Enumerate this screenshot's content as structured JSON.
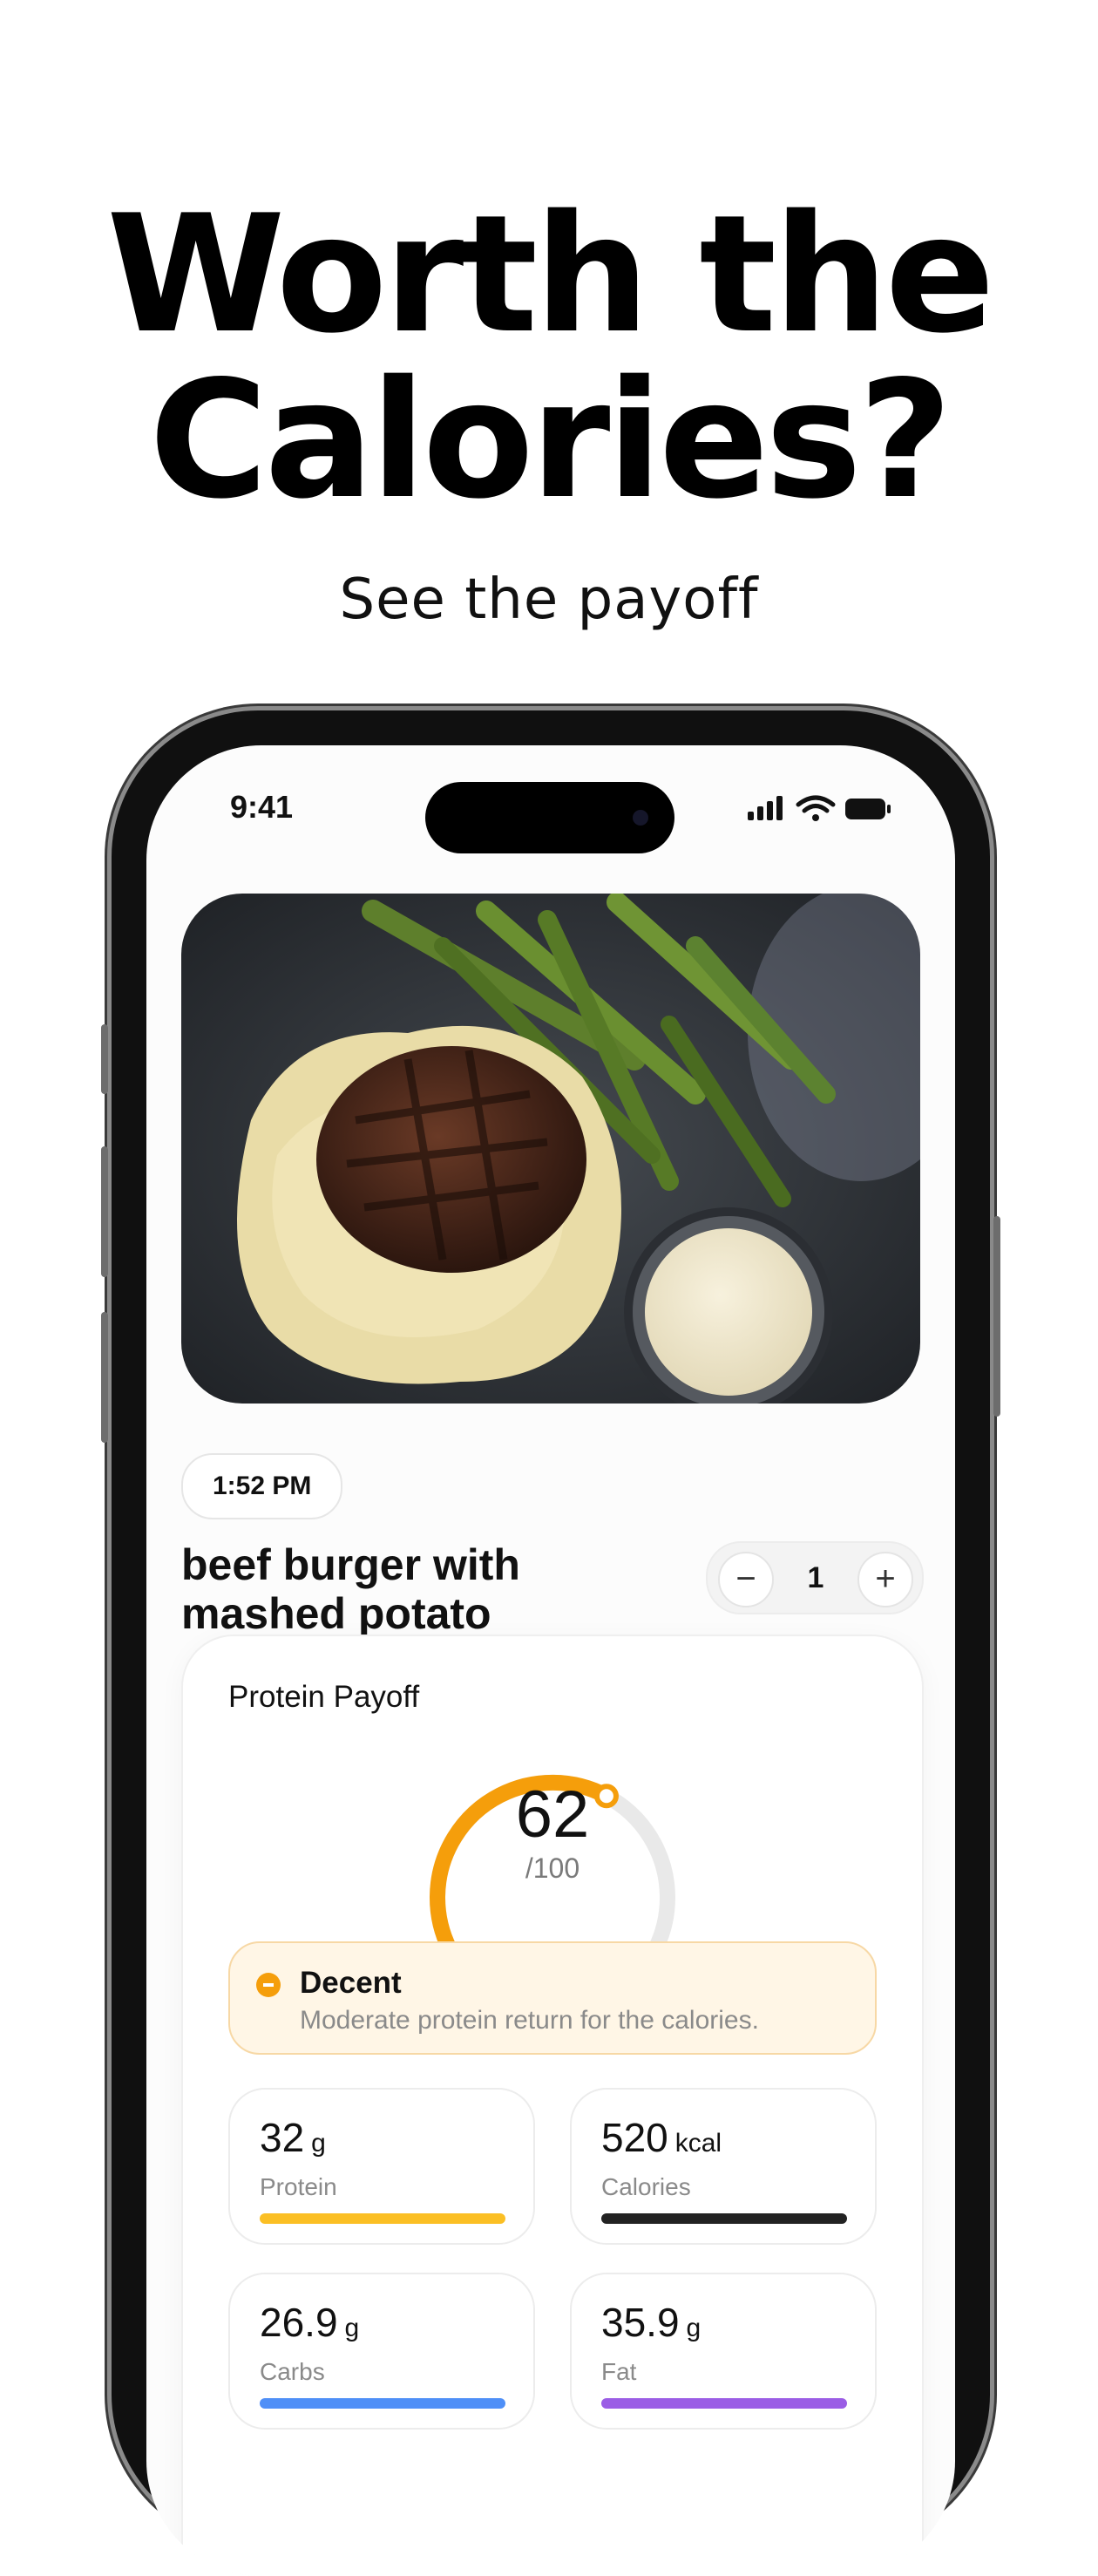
{
  "headline": {
    "line1": "Worth the",
    "line2": "Calories?",
    "subtitle": "See the payoff"
  },
  "status_bar": {
    "time": "9:41"
  },
  "meal": {
    "logged_time": "1:52 PM",
    "title": "beef burger with mashed potato",
    "quantity": "1",
    "decrement_symbol": "−",
    "increment_symbol": "+"
  },
  "payoff": {
    "title": "Protein Payoff",
    "score": "62",
    "score_max": "/100",
    "score_fraction": 0.62,
    "accent_color": "#f59e0b",
    "verdict": {
      "label": "Decent",
      "description": "Moderate protein return for the calories."
    }
  },
  "stats": [
    {
      "value": "32",
      "unit": "g",
      "label": "Protein",
      "color": "#fbbf24"
    },
    {
      "value": "520",
      "unit": "kcal",
      "label": "Calories",
      "color": "#222222"
    },
    {
      "value": "26.9",
      "unit": "g",
      "label": "Carbs",
      "color": "#4f8ff7"
    },
    {
      "value": "35.9",
      "unit": "g",
      "label": "Fat",
      "color": "#9b5de5"
    }
  ],
  "icons": {
    "status": [
      "cellular-signal-icon",
      "wifi-icon",
      "battery-icon"
    ],
    "quantity": [
      "minus-icon",
      "plus-icon"
    ],
    "verdict": "minus-circle-icon"
  }
}
